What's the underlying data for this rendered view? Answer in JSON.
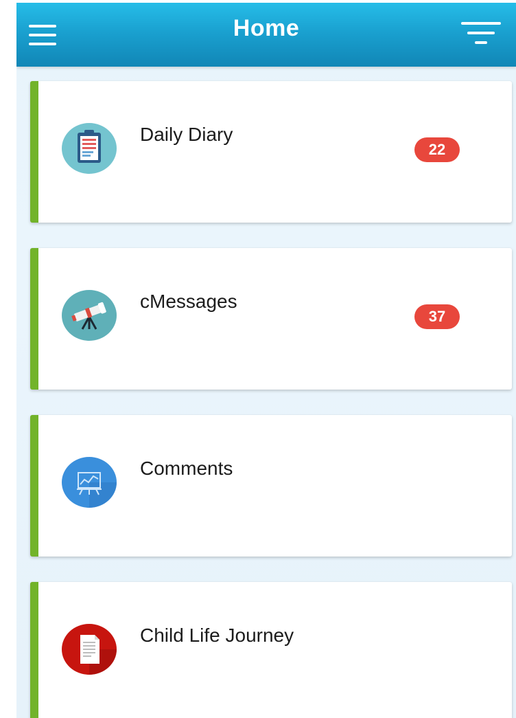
{
  "header": {
    "title": "Home"
  },
  "icons": {
    "menu": "hamburger-menu-icon",
    "filter": "filter-icon"
  },
  "colors": {
    "header_top": "#26bde8",
    "header_bottom": "#1186b6",
    "card_accent": "#72b32a",
    "badge": "#e8473c"
  },
  "menu_items": [
    {
      "label": "Daily Diary",
      "badge": "22",
      "icon": "clipboard-icon"
    },
    {
      "label": "cMessages",
      "badge": "37",
      "icon": "telescope-icon"
    },
    {
      "label": "Comments",
      "badge": "",
      "icon": "presentation-board-icon"
    },
    {
      "label": "Child Life Journey",
      "badge": "",
      "icon": "document-icon"
    }
  ]
}
